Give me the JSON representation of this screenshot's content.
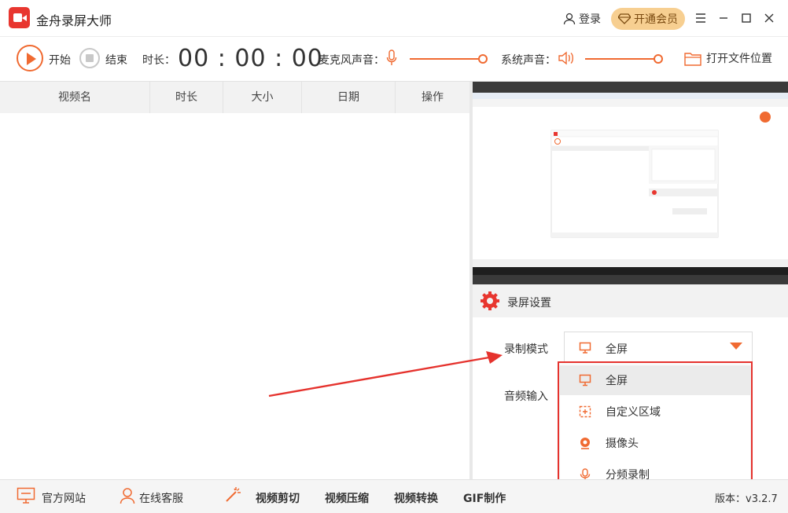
{
  "app": {
    "title": "金舟录屏大师"
  },
  "titlebar": {
    "login_label": "登录",
    "vip_label": "开通会员"
  },
  "toolbar": {
    "start_label": "开始",
    "stop_label": "结束",
    "duration_label": "时长：",
    "duration_value": "00 : 00 : 00",
    "mic_label": "麦克风声音：",
    "system_label": "系统声音：",
    "open_folder_label": "打开文件位置",
    "mic_volume": 1.0,
    "system_volume": 1.0
  },
  "table": {
    "columns": [
      "视频名",
      "时长",
      "大小",
      "日期",
      "操作"
    ],
    "rows": []
  },
  "settings": {
    "title": "录屏设置",
    "record_mode_label": "录制模式",
    "audio_input_label": "音频输入",
    "record_mode_value": "全屏",
    "record_mode_options": [
      "全屏",
      "自定义区域",
      "摄像头",
      "分频录制"
    ]
  },
  "statusbar": {
    "website": "官方网站",
    "support": "在线客服",
    "video_cut": "视频剪切",
    "video_compress": "视频压缩",
    "video_convert": "视频转换",
    "gif": "GIF制作",
    "version": "版本：v3.2.7"
  },
  "colors": {
    "accent": "#f06a31",
    "brand_red": "#e8362f",
    "vip_gold": "#f7cf91",
    "annotation_red": "#e5322d"
  }
}
